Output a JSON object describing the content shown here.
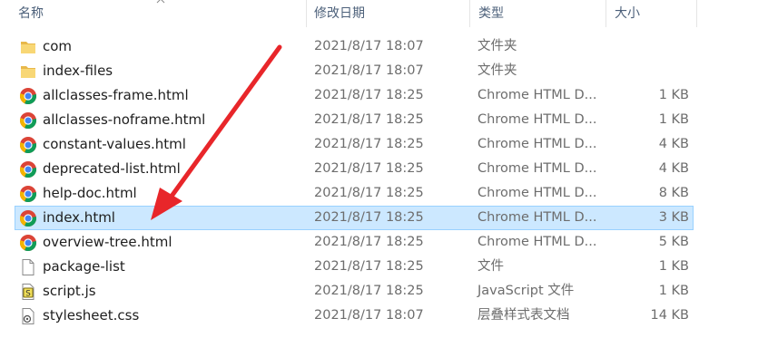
{
  "columns": {
    "name": "名称",
    "date": "修改日期",
    "type": "类型",
    "size": "大小"
  },
  "files": [
    {
      "name": "com",
      "date": "2021/8/17 18:07",
      "type": "文件夹",
      "size": "",
      "icon": "folder-icon",
      "selected": false
    },
    {
      "name": "index-files",
      "date": "2021/8/17 18:07",
      "type": "文件夹",
      "size": "",
      "icon": "folder-icon",
      "selected": false
    },
    {
      "name": "allclasses-frame.html",
      "date": "2021/8/17 18:25",
      "type": "Chrome HTML D...",
      "size": "1 KB",
      "icon": "chrome-icon",
      "selected": false
    },
    {
      "name": "allclasses-noframe.html",
      "date": "2021/8/17 18:25",
      "type": "Chrome HTML D...",
      "size": "1 KB",
      "icon": "chrome-icon",
      "selected": false
    },
    {
      "name": "constant-values.html",
      "date": "2021/8/17 18:25",
      "type": "Chrome HTML D...",
      "size": "4 KB",
      "icon": "chrome-icon",
      "selected": false
    },
    {
      "name": "deprecated-list.html",
      "date": "2021/8/17 18:25",
      "type": "Chrome HTML D...",
      "size": "4 KB",
      "icon": "chrome-icon",
      "selected": false
    },
    {
      "name": "help-doc.html",
      "date": "2021/8/17 18:25",
      "type": "Chrome HTML D...",
      "size": "8 KB",
      "icon": "chrome-icon",
      "selected": false
    },
    {
      "name": "index.html",
      "date": "2021/8/17 18:25",
      "type": "Chrome HTML D...",
      "size": "3 KB",
      "icon": "chrome-icon",
      "selected": true
    },
    {
      "name": "overview-tree.html",
      "date": "2021/8/17 18:25",
      "type": "Chrome HTML D...",
      "size": "5 KB",
      "icon": "chrome-icon",
      "selected": false
    },
    {
      "name": "package-list",
      "date": "2021/8/17 18:25",
      "type": "文件",
      "size": "1 KB",
      "icon": "blank-file-icon",
      "selected": false
    },
    {
      "name": "script.js",
      "date": "2021/8/17 18:25",
      "type": "JavaScript 文件",
      "size": "1 KB",
      "icon": "script-file-icon",
      "selected": false
    },
    {
      "name": "stylesheet.css",
      "date": "2021/8/17 18:07",
      "type": "层叠样式表文档",
      "size": "14 KB",
      "icon": "css-file-icon",
      "selected": false
    }
  ],
  "annotation": {
    "color": "#e8262a",
    "icon": "red-arrow"
  },
  "colors": {
    "selection_bg": "#cce8ff",
    "selection_border": "#99d1ff",
    "header_text": "#4c607a"
  }
}
